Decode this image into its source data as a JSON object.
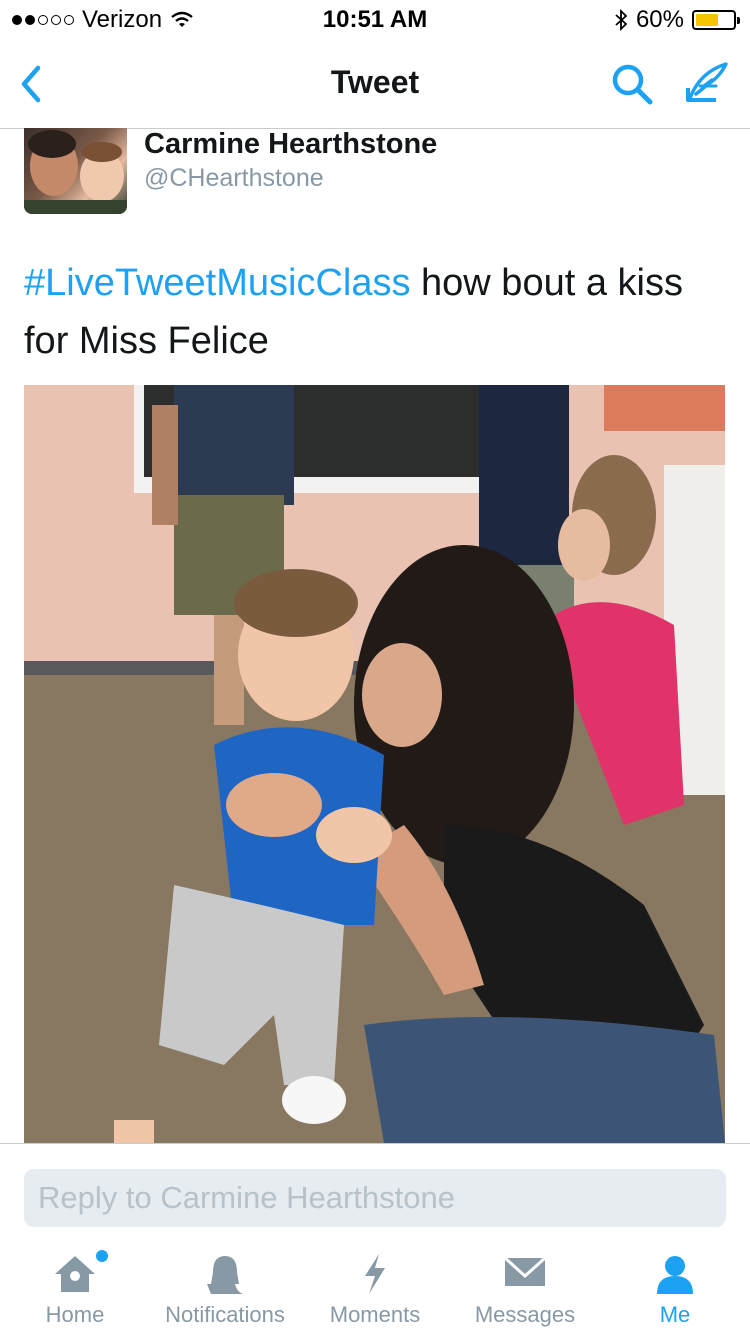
{
  "status_bar": {
    "carrier": "Verizon",
    "time": "10:51 AM",
    "battery": "60%",
    "battery_level": 0.6,
    "signal_dots": [
      true,
      true,
      false,
      false,
      false
    ]
  },
  "nav": {
    "title": "Tweet",
    "back_icon": "chevron-left-icon",
    "search_icon": "search-icon",
    "compose_icon": "compose-icon"
  },
  "tweet": {
    "author_name": "Carmine Hearthstone",
    "author_handle": "@CHearthstone",
    "hashtag": "#LiveTweetMusicClass",
    "text": " how bout a kiss for Miss Felice"
  },
  "reply": {
    "placeholder": "Reply to Carmine Hearthstone"
  },
  "tabs": [
    {
      "label": "Home",
      "icon": "home-icon",
      "active": false,
      "badge": true
    },
    {
      "label": "Notifications",
      "icon": "bell-icon",
      "active": false,
      "badge": false
    },
    {
      "label": "Moments",
      "icon": "lightning-icon",
      "active": false,
      "badge": false
    },
    {
      "label": "Messages",
      "icon": "envelope-icon",
      "active": false,
      "badge": false
    },
    {
      "label": "Me",
      "icon": "person-icon",
      "active": true,
      "badge": false
    }
  ],
  "colors": {
    "accent": "#1da1f2",
    "inactive": "#8899a6",
    "battery_fill": "#f5c400"
  }
}
